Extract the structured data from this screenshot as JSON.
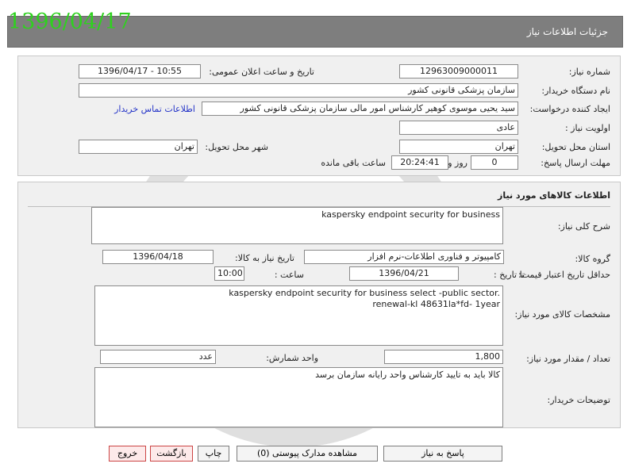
{
  "date_stamp": "1396/04/17",
  "window": {
    "title": "جزئیات اطلاعات نیاز"
  },
  "need": {
    "number_label": "شماره نیاز:",
    "number_value": "1296300900001‌1",
    "announce_label": "تاریخ و ساعت اعلان عمومی:",
    "announce_value": "1396/04/17 - 10:55",
    "buyer_label": "نام دستگاه خریدار:",
    "buyer_value": "سازمان پزشکی قانونی کشور",
    "creator_label": "ایجاد کننده درخواست:",
    "creator_value": "سید یحیی موسوی کوهیر کارشناس امور مالی سازمان پزشکی قانونی کشور",
    "contact_link": "اطلاعات تماس خریدار",
    "priority_label": "اولویت نیاز :",
    "priority_value": "عادی",
    "province_label": "استان محل تحویل:",
    "province_value": "تهران",
    "city_label": "شهر محل تحویل:",
    "city_value": "تهران",
    "deadline_label": "مهلت ارسال پاسخ:",
    "deadline_days": "0",
    "days_text": "روز و",
    "deadline_time": "20:24:41",
    "remaining_text": "ساعت باقی مانده"
  },
  "goods": {
    "section_title": "اطلاعات کالاهای مورد نیاز",
    "summary_label": "شرح کلی نیاز:",
    "summary_value": "kaspersky endpoint security for business",
    "group_label": "گروه کالا:",
    "group_value": "کامپیوتر و فناوری اطلاعات-نرم افزار",
    "need_date_label": "تاریخ نیاز به کالا:",
    "need_date_value": "1396/04/18",
    "price_valid_label": "حداقل تاریخ اعتبار قیمت:",
    "until_date_label": "تا تاریخ :",
    "until_date_value": "1396/04/21",
    "time_label": "ساعت :",
    "time_value": "10:00",
    "spec_label": "مشخصات کالای مورد نیاز:",
    "spec_line1": "kaspersky endpoint security for business select -public sector.",
    "spec_line2": "renewal-kl 48631la*fd- 1year",
    "qty_label": "تعداد / مقدار مورد نیاز:",
    "qty_value": "1,800",
    "unit_label": "واحد شمارش:",
    "unit_value": "عدد",
    "notes_label": "توضیحات خریدار:",
    "notes_value": "کالا باید به تایید کارشناس واحد رایانه سازمان برسد"
  },
  "buttons": {
    "reply": "پاسخ به نیاز",
    "attachments": "مشاهده مدارک پیوستی (0)",
    "print": "چاپ",
    "back": "بازگشت",
    "exit": "خروج"
  }
}
